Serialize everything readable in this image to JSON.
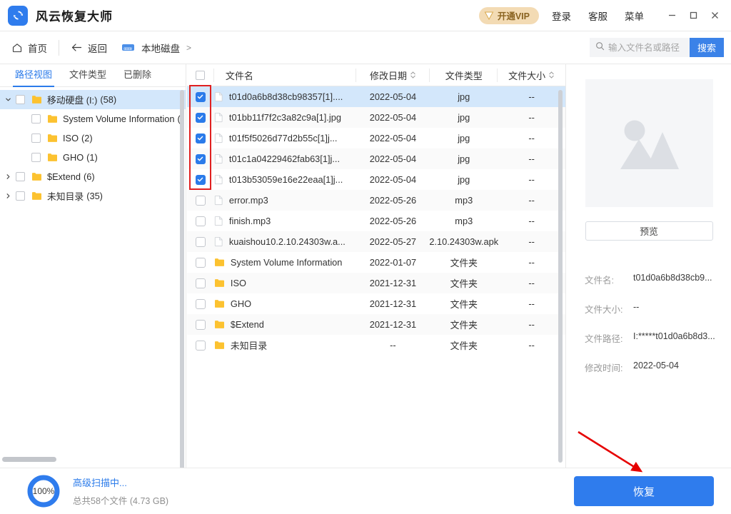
{
  "titlebar": {
    "app_title": "风云恢复大师",
    "logo_icon": "recovery-logo-icon",
    "vip_label": "开通VIP",
    "vip_badge_icon": "vip-v-badge-icon",
    "login_label": "登录",
    "support_label": "客服",
    "menu_label": "菜单",
    "minimize_icon": "minimize-icon",
    "maximize_icon": "maximize-icon",
    "close_icon": "close-icon",
    "accent_color": "#2f7ced",
    "vip_bg_color": "#f3dbb4"
  },
  "toolbar": {
    "home_label": "首页",
    "home_icon": "home-icon",
    "back_label": "返回",
    "back_icon": "arrow-left-icon",
    "breadcrumb_icon": "disk-icon",
    "breadcrumb_label": "本地磁盘",
    "breadcrumb_sep": ">",
    "search_placeholder": "输入文件名或路径",
    "search_value": "",
    "search_icon": "search-icon",
    "search_button": "搜索"
  },
  "sidebar": {
    "tabs": [
      {
        "label": "路径视图",
        "active": true
      },
      {
        "label": "文件类型",
        "active": false
      },
      {
        "label": "已删除",
        "active": false
      }
    ],
    "tree": [
      {
        "label": "移动硬盘 (I:)",
        "count": "(58)",
        "chevron": "chevron-down",
        "indent": 0,
        "selected": true
      },
      {
        "label": "System Volume Information",
        "count": "(",
        "chevron": "",
        "indent": 1,
        "selected": false
      },
      {
        "label": "ISO",
        "count": "(2)",
        "chevron": "",
        "indent": 1,
        "selected": false
      },
      {
        "label": "GHO",
        "count": "(1)",
        "chevron": "",
        "indent": 1,
        "selected": false
      },
      {
        "label": "$Extend",
        "count": "(6)",
        "chevron": "chevron-right",
        "indent": 0,
        "selected": false
      },
      {
        "label": "未知目录",
        "count": "(35)",
        "chevron": "chevron-right",
        "indent": 0,
        "selected": false
      }
    ]
  },
  "filelist": {
    "columns": [
      {
        "key": "check",
        "label": ""
      },
      {
        "key": "name",
        "label": "文件名",
        "sortable": false
      },
      {
        "key": "date",
        "label": "修改日期",
        "sortable": true
      },
      {
        "key": "type",
        "label": "文件类型",
        "sortable": false
      },
      {
        "key": "size",
        "label": "文件大小",
        "sortable": true
      }
    ],
    "rows": [
      {
        "name": "t01d0a6b8d38cb98357[1]....",
        "date": "2022-05-04",
        "type": "jpg",
        "size": "--",
        "checked": true,
        "selected": true,
        "icon": "file-icon"
      },
      {
        "name": "t01bb11f7f2c3a82c9a[1].jpg",
        "date": "2022-05-04",
        "type": "jpg",
        "size": "--",
        "checked": true,
        "selected": false,
        "icon": "file-icon"
      },
      {
        "name": "t01f5f5026d77d2b55c[1]j...",
        "date": "2022-05-04",
        "type": "jpg",
        "size": "--",
        "checked": true,
        "selected": false,
        "icon": "file-icon"
      },
      {
        "name": "t01c1a04229462fab63[1]j...",
        "date": "2022-05-04",
        "type": "jpg",
        "size": "--",
        "checked": true,
        "selected": false,
        "icon": "file-icon"
      },
      {
        "name": "t013b53059e16e22eaa[1]j...",
        "date": "2022-05-04",
        "type": "jpg",
        "size": "--",
        "checked": true,
        "selected": false,
        "icon": "file-icon"
      },
      {
        "name": "error.mp3",
        "date": "2022-05-26",
        "type": "mp3",
        "size": "--",
        "checked": false,
        "selected": false,
        "icon": "file-icon"
      },
      {
        "name": "finish.mp3",
        "date": "2022-05-26",
        "type": "mp3",
        "size": "--",
        "checked": false,
        "selected": false,
        "icon": "file-icon"
      },
      {
        "name": "kuaishou10.2.10.24303w.a...",
        "date": "2022-05-27",
        "type": "2.10.24303w.apk",
        "size": "--",
        "checked": false,
        "selected": false,
        "icon": "file-icon"
      },
      {
        "name": "System Volume Information",
        "date": "2022-01-07",
        "type": "文件夹",
        "size": "--",
        "checked": false,
        "selected": false,
        "icon": "folder-icon"
      },
      {
        "name": "ISO",
        "date": "2021-12-31",
        "type": "文件夹",
        "size": "--",
        "checked": false,
        "selected": false,
        "icon": "folder-icon"
      },
      {
        "name": "GHO",
        "date": "2021-12-31",
        "type": "文件夹",
        "size": "--",
        "checked": false,
        "selected": false,
        "icon": "folder-icon"
      },
      {
        "name": "$Extend",
        "date": "2021-12-31",
        "type": "文件夹",
        "size": "--",
        "checked": false,
        "selected": false,
        "icon": "folder-icon"
      },
      {
        "name": "未知目录",
        "date": "--",
        "type": "文件夹",
        "size": "--",
        "checked": false,
        "selected": false,
        "icon": "folder-icon"
      }
    ]
  },
  "preview": {
    "placeholder_icon": "image-placeholder-icon",
    "button_label": "预览",
    "meta": [
      {
        "key": "文件名:",
        "value": "t01d0a6b8d38cb9..."
      },
      {
        "key": "文件大小:",
        "value": "--"
      },
      {
        "key": "文件路径:",
        "value": "I:*****t01d0a6b8d3..."
      },
      {
        "key": "修改时间:",
        "value": "2022-05-04"
      }
    ]
  },
  "status": {
    "progress_percent": "100%",
    "progress_value": 100,
    "title": "高级扫描中...",
    "subtitle": "总共58个文件 (4.73 GB)",
    "recover_label": "恢复",
    "ring_color": "#2f7ced"
  },
  "annotations": {
    "rect_color": "#e02020",
    "arrow_color": "#e60000"
  }
}
